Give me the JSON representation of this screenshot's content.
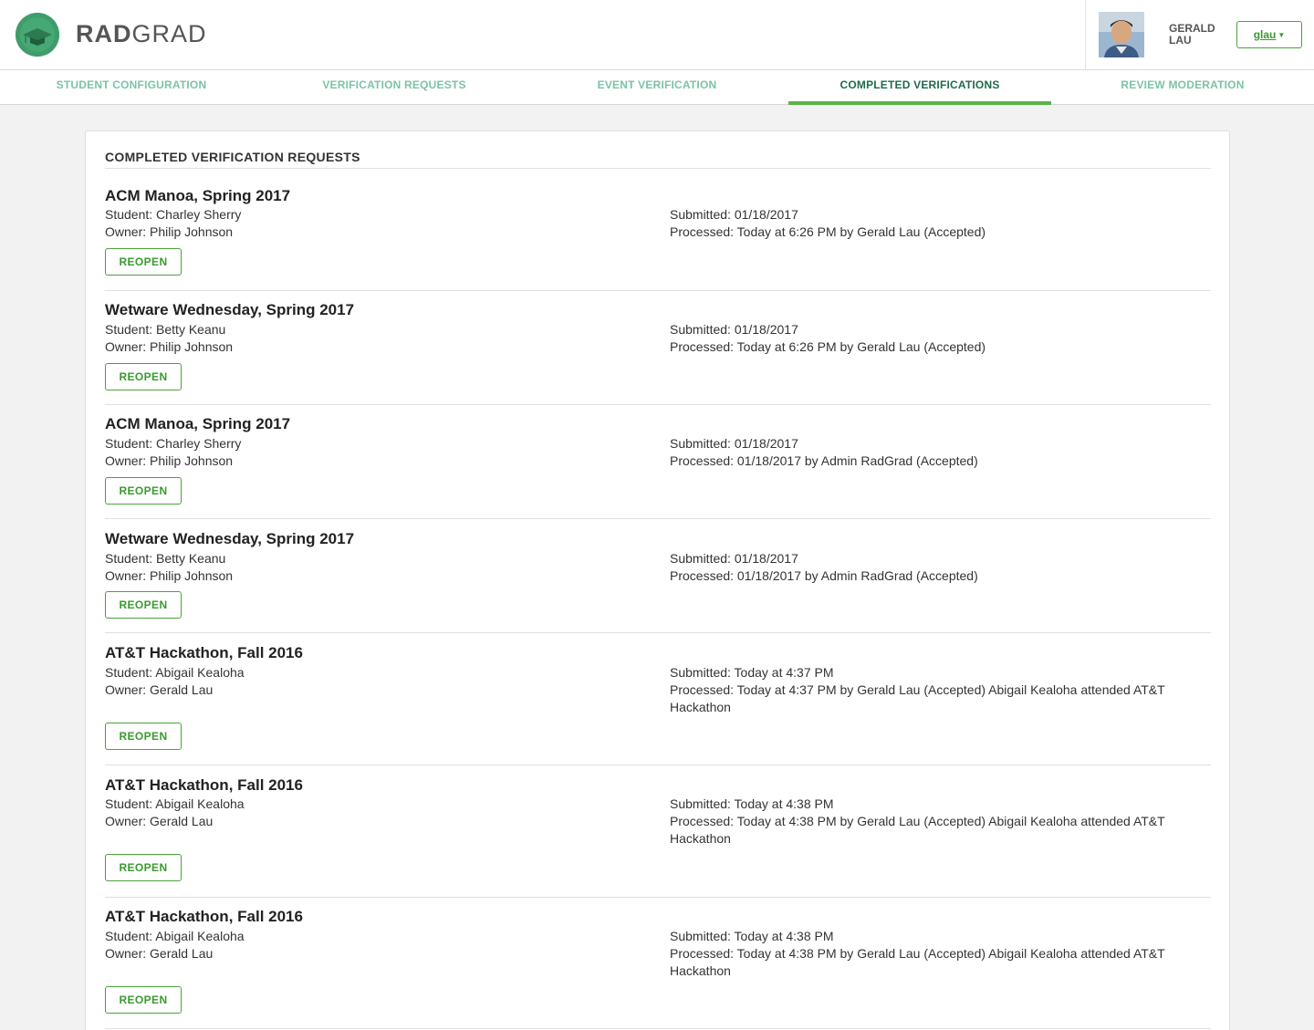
{
  "header": {
    "brand_part1": "RAD",
    "brand_part2": "GRAD",
    "user_first": "GERALD",
    "user_last": "LAU",
    "user_menu_label": "glau",
    "logo_icon": "graduation-cap-icon",
    "caret_icon": "caret-down-icon"
  },
  "nav": {
    "tabs": [
      {
        "label": "STUDENT CONFIGURATION"
      },
      {
        "label": "VERIFICATION REQUESTS"
      },
      {
        "label": "EVENT VERIFICATION"
      },
      {
        "label": "COMPLETED VERIFICATIONS"
      },
      {
        "label": "REVIEW MODERATION"
      }
    ],
    "active_index": 3
  },
  "card": {
    "title": "COMPLETED VERIFICATION REQUESTS"
  },
  "entries": [
    {
      "title": "ACM Manoa, Spring 2017",
      "student": "Student: Charley Sherry",
      "owner": "Owner: Philip Johnson",
      "submitted": "Submitted: 01/18/2017",
      "processed": "Processed: Today at 6:26 PM by Gerald Lau (Accepted)",
      "button": "REOPEN"
    },
    {
      "title": "Wetware Wednesday, Spring 2017",
      "student": "Student: Betty Keanu",
      "owner": "Owner: Philip Johnson",
      "submitted": "Submitted: 01/18/2017",
      "processed": "Processed: Today at 6:26 PM by Gerald Lau (Accepted)",
      "button": "REOPEN"
    },
    {
      "title": "ACM Manoa, Spring 2017",
      "student": "Student: Charley Sherry",
      "owner": "Owner: Philip Johnson",
      "submitted": "Submitted: 01/18/2017",
      "processed": "Processed: 01/18/2017 by Admin RadGrad (Accepted)",
      "button": "REOPEN"
    },
    {
      "title": "Wetware Wednesday, Spring 2017",
      "student": "Student: Betty Keanu",
      "owner": "Owner: Philip Johnson",
      "submitted": "Submitted: 01/18/2017",
      "processed": "Processed: 01/18/2017 by Admin RadGrad (Accepted)",
      "button": "REOPEN"
    },
    {
      "title": "AT&T Hackathon, Fall 2016",
      "student": "Student: Abigail Kealoha",
      "owner": "Owner: Gerald Lau",
      "submitted": "Submitted: Today at 4:37 PM",
      "processed": "Processed: Today at 4:37 PM by Gerald Lau (Accepted) Abigail Kealoha attended AT&T Hackathon",
      "button": "REOPEN"
    },
    {
      "title": "AT&T Hackathon, Fall 2016",
      "student": "Student: Abigail Kealoha",
      "owner": "Owner: Gerald Lau",
      "submitted": "Submitted: Today at 4:38 PM",
      "processed": "Processed: Today at 4:38 PM by Gerald Lau (Accepted) Abigail Kealoha attended AT&T Hackathon",
      "button": "REOPEN"
    },
    {
      "title": "AT&T Hackathon, Fall 2016",
      "student": "Student: Abigail Kealoha",
      "owner": "Owner: Gerald Lau",
      "submitted": "Submitted: Today at 4:38 PM",
      "processed": "Processed: Today at 4:38 PM by Gerald Lau (Accepted) Abigail Kealoha attended AT&T Hackathon",
      "button": "REOPEN"
    }
  ],
  "colors": {
    "accent_green": "#4aa33b",
    "tab_inactive": "#7cc3a5",
    "tab_active": "#1f6b4c",
    "logo_green": "#3f9d6b"
  }
}
